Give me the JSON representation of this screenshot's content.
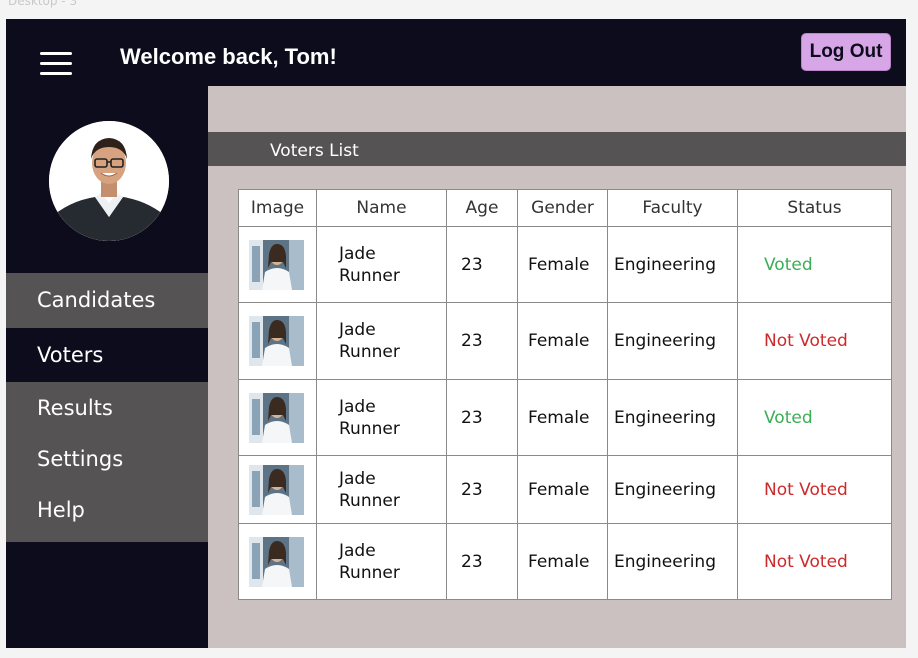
{
  "frame": {
    "label": "Desktop - 3"
  },
  "header": {
    "welcome": "Welcome back, Tom!",
    "logout_label": "Log Out"
  },
  "sidebar": {
    "items": [
      {
        "label": "Candidates"
      },
      {
        "label": "Voters"
      },
      {
        "label": "Results"
      },
      {
        "label": "Settings"
      },
      {
        "label": "Help"
      }
    ]
  },
  "main": {
    "list_title": "Voters List",
    "columns": [
      "Image",
      "Name",
      "Age",
      "Gender",
      "Faculty",
      "Status"
    ],
    "rows": [
      {
        "name_first": "Jade",
        "name_last": "Runner",
        "age": "23",
        "gender": "Female",
        "faculty": "Engineering",
        "status": "Voted"
      },
      {
        "name_first": "Jade",
        "name_last": "Runner",
        "age": "23",
        "gender": "Female",
        "faculty": "Engineering",
        "status": "Not Voted"
      },
      {
        "name_first": "Jade",
        "name_last": "Runner",
        "age": "23",
        "gender": "Female",
        "faculty": "Engineering",
        "status": "Voted"
      },
      {
        "name_first": "Jade",
        "name_last": "Runner",
        "age": "23",
        "gender": "Female",
        "faculty": "Engineering",
        "status": "Not Voted"
      },
      {
        "name_first": "Jade",
        "name_last": "Runner",
        "age": "23",
        "gender": "Female",
        "faculty": "Engineering",
        "status": "Not Voted"
      }
    ]
  },
  "colors": {
    "voted": "#3bae55",
    "not_voted": "#cc2a2a",
    "accent": "#d7a6e6",
    "dark": "#0d0c1d",
    "panel": "#555353",
    "content_bg": "#cbc1c0"
  }
}
